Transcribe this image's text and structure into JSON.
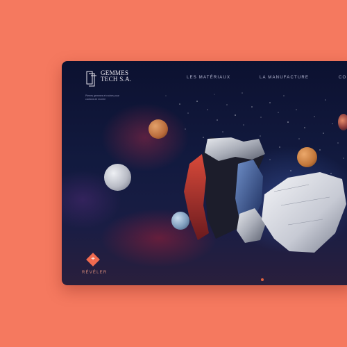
{
  "brand": {
    "name_line1": "GEMMES",
    "name_line2": "TECH S.A.",
    "tagline": "Pierres gemmes et roches pour cadrans de montre"
  },
  "nav": {
    "items": [
      "LES MATÉRIAUX",
      "LA MANUFACTURE",
      "CO"
    ]
  },
  "hero": {
    "reveal_label": "RÉVÉLER",
    "reveal_icon": "plus-icon"
  },
  "colors": {
    "page_background": "#f5795f",
    "accent": "#f06a4f",
    "screen_background": "#121a3f"
  }
}
